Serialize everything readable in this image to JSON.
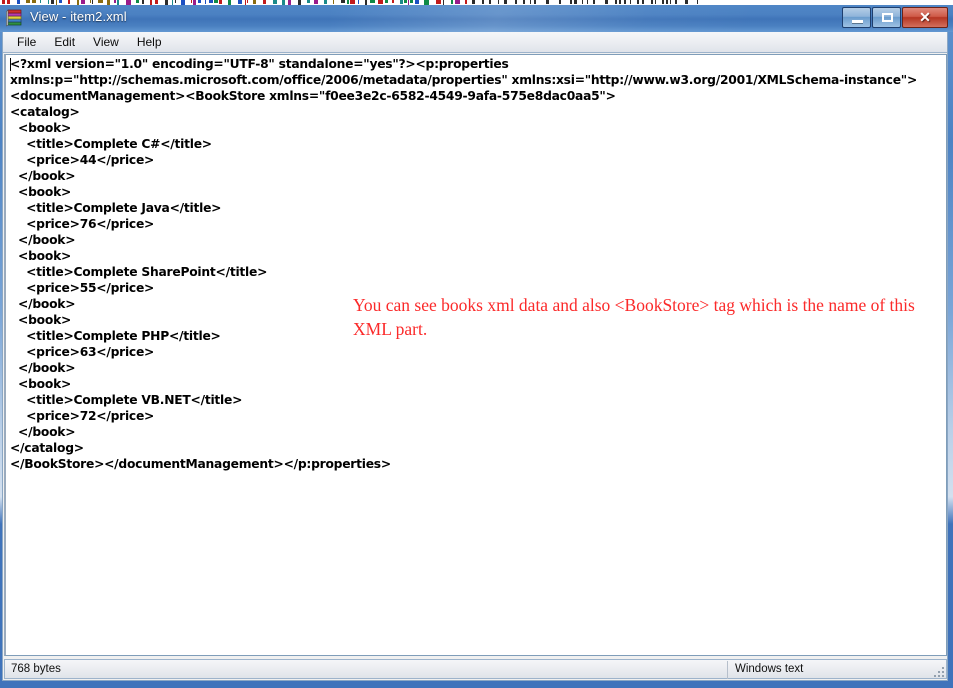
{
  "window": {
    "title": "View - item2.xml",
    "icon": "book-stack-icon",
    "controls": {
      "minimize": "minimize-button",
      "maximize": "maximize-button",
      "close": "✕"
    }
  },
  "menubar": {
    "items": [
      {
        "label": "File"
      },
      {
        "label": "Edit"
      },
      {
        "label": "View"
      },
      {
        "label": "Help"
      }
    ]
  },
  "editor": {
    "content": "<?xml version=\"1.0\" encoding=\"UTF-8\" standalone=\"yes\"?><p:properties\nxmlns:p=\"http://schemas.microsoft.com/office/2006/metadata/properties\" xmlns:xsi=\"http://www.w3.org/2001/XMLSchema-instance\">\n<documentManagement><BookStore xmlns=\"f0ee3e2c-6582-4549-9afa-575e8dac0aa5\">\n<catalog>\n  <book>\n    <title>Complete C#</title>\n    <price>44</price>\n  </book>\n  <book>\n    <title>Complete Java</title>\n    <price>76</price>\n  </book>\n  <book>\n    <title>Complete SharePoint</title>\n    <price>55</price>\n  </book>\n  <book>\n    <title>Complete PHP</title>\n    <price>63</price>\n  </book>\n  <book>\n    <title>Complete VB.NET</title>\n    <price>72</price>\n  </book>\n</catalog>\n</BookStore></documentManagement></p:properties>"
  },
  "xml_model": {
    "declaration": {
      "version": "1.0",
      "encoding": "UTF-8",
      "standalone": "yes"
    },
    "root": "p:properties",
    "namespaces": {
      "p": "http://schemas.microsoft.com/office/2006/metadata/properties",
      "xsi": "http://www.w3.org/2001/XMLSchema-instance",
      "BookStore": "f0ee3e2c-6582-4549-9afa-575e8dac0aa5"
    },
    "catalog": [
      {
        "title": "Complete C#",
        "price": "44"
      },
      {
        "title": "Complete Java",
        "price": "76"
      },
      {
        "title": "Complete SharePoint",
        "price": "55"
      },
      {
        "title": "Complete PHP",
        "price": "63"
      },
      {
        "title": "Complete VB.NET",
        "price": "72"
      }
    ]
  },
  "annotation": {
    "text": "You can see books xml data and also <BookStore> tag which is the name of this XML part.",
    "color": "#fb2a2a"
  },
  "statusbar": {
    "left": "768 bytes",
    "right": "Windows text"
  },
  "colors": {
    "titlebar_blue": "#4b81c2",
    "frame_blue": "#3f73bb",
    "close_red": "#b53522",
    "annotation_red": "#fb2a2a"
  }
}
